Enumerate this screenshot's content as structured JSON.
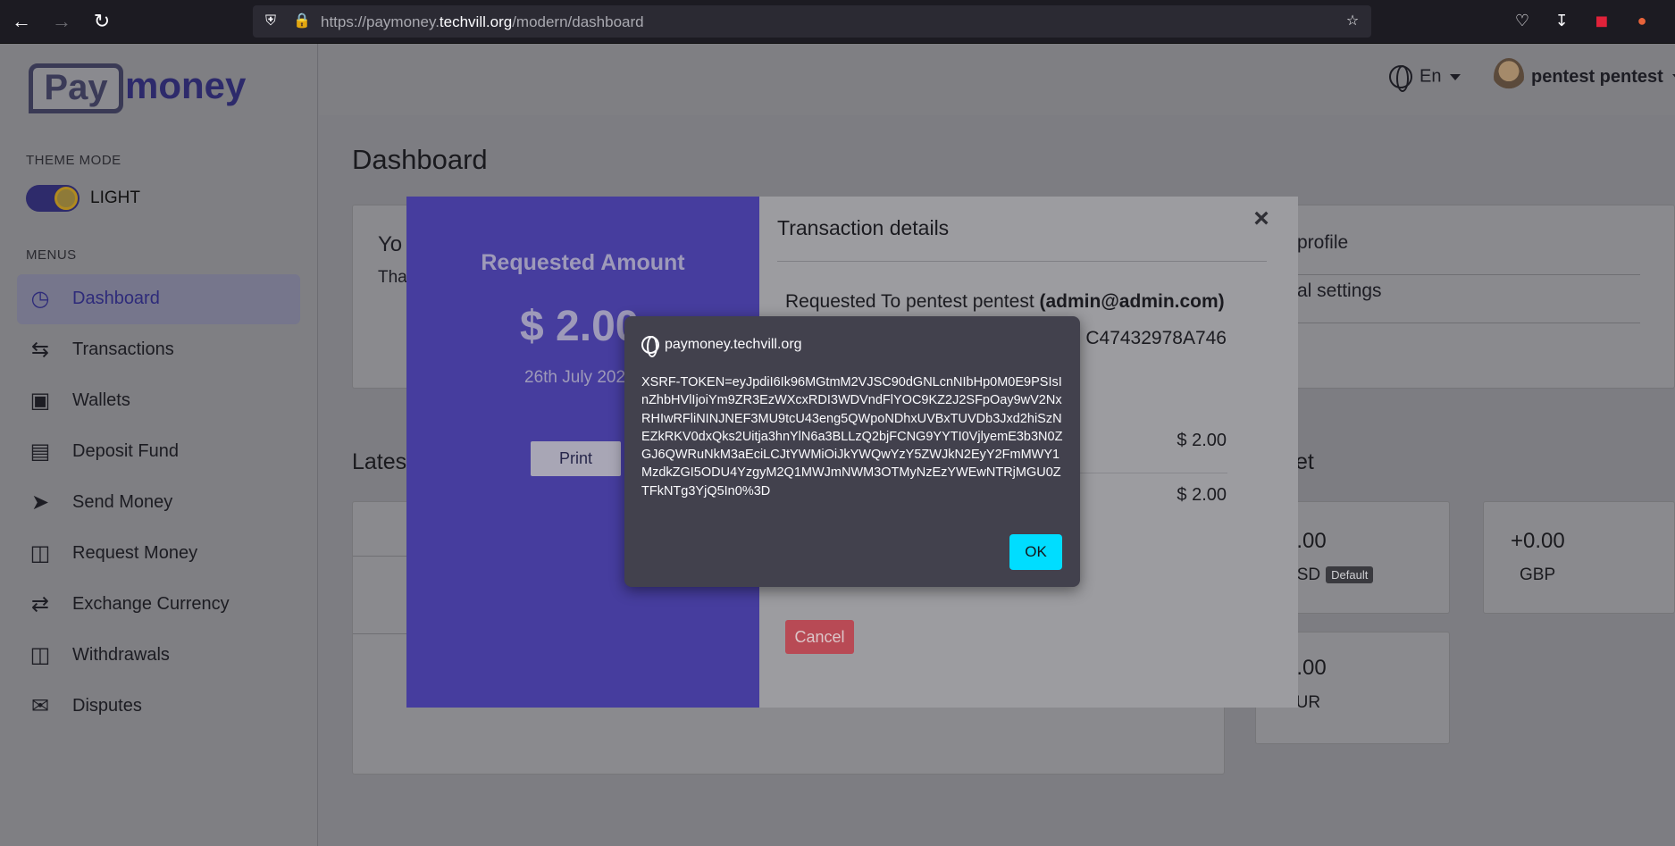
{
  "browser": {
    "url_prefix": "https://paymoney.",
    "url_host": "techvill.org",
    "url_path": "/modern/dashboard"
  },
  "sidebar": {
    "logo_pay": "Pay",
    "logo_money": "money",
    "theme_mode_label": "THEME MODE",
    "theme_value": "LIGHT",
    "menus_label": "MENUS",
    "items": [
      {
        "label": "Dashboard",
        "icon": "dashboard-icon"
      },
      {
        "label": "Transactions",
        "icon": "transactions-icon"
      },
      {
        "label": "Wallets",
        "icon": "wallet-icon"
      },
      {
        "label": "Deposit Fund",
        "icon": "deposit-icon"
      },
      {
        "label": "Send Money",
        "icon": "send-icon"
      },
      {
        "label": "Request Money",
        "icon": "request-money-icon"
      },
      {
        "label": "Exchange Currency",
        "icon": "exchange-icon"
      },
      {
        "label": "Withdrawals",
        "icon": "withdrawal-icon"
      },
      {
        "label": "Disputes",
        "icon": "disputes-icon"
      }
    ]
  },
  "header": {
    "language": "En",
    "user_name": "pentest pentest"
  },
  "main": {
    "title": "Dashboard",
    "welcome_partial": "Yo",
    "welcome_sub_partial": "Tha",
    "quick_links": [
      "profile",
      "al settings"
    ],
    "latest_partial": "Latest",
    "wallet_partial": "et",
    "wallets": [
      {
        "amount": "0.00",
        "currency": "USD",
        "badge": "Default"
      },
      {
        "amount": "+0.00",
        "currency": "GBP"
      },
      {
        "amount": "0.00",
        "currency": "EUR"
      }
    ]
  },
  "modal": {
    "left_title": "Requested Amount",
    "amount": "$ 2.00",
    "date": "26th July 2023",
    "print_label": "Print",
    "title": "Transaction details",
    "close_label": "×",
    "requested_to_label": "Requested To pentest pentest",
    "requested_to_email": "(admin@admin.com)",
    "transaction_id": "C47432978A746",
    "amount_row_1": "$ 2.00",
    "amount_row_2": "$ 2.00",
    "cancel_label": "Cancel"
  },
  "alert": {
    "origin": "paymoney.techvill.org",
    "message": "XSRF-TOKEN=eyJpdiI6Ik96MGtmM2VJSC90dGNLcnNIbHp0M0E9PSIsInZhbHVlIjoiYm9ZR3EzWXcxRDI3WDVndFlYOC9KZ2J2SFpOay9wV2NxRHIwRFliNINJNEF3MU9tcU43eng5QWpoNDhxUVBxTUVDb3Jxd2hiSzNEZkRKV0dxQks2Uitja3hnYlN6a3BLLzQ2bjFCNG9YYTI0VjlyemE3b3N0ZGJ6QWRuNkM3aEciLCJtYWMiOiJkYWQwYzY5ZWJkN2EyY2FmMWY1MzdkZGI5ODU4YzgyM2Q1MWJmNWM3OTMyNzEzYWEwNTRjMGU0ZTFkNTg3YjQ5In0%3D",
    "ok_label": "OK"
  }
}
